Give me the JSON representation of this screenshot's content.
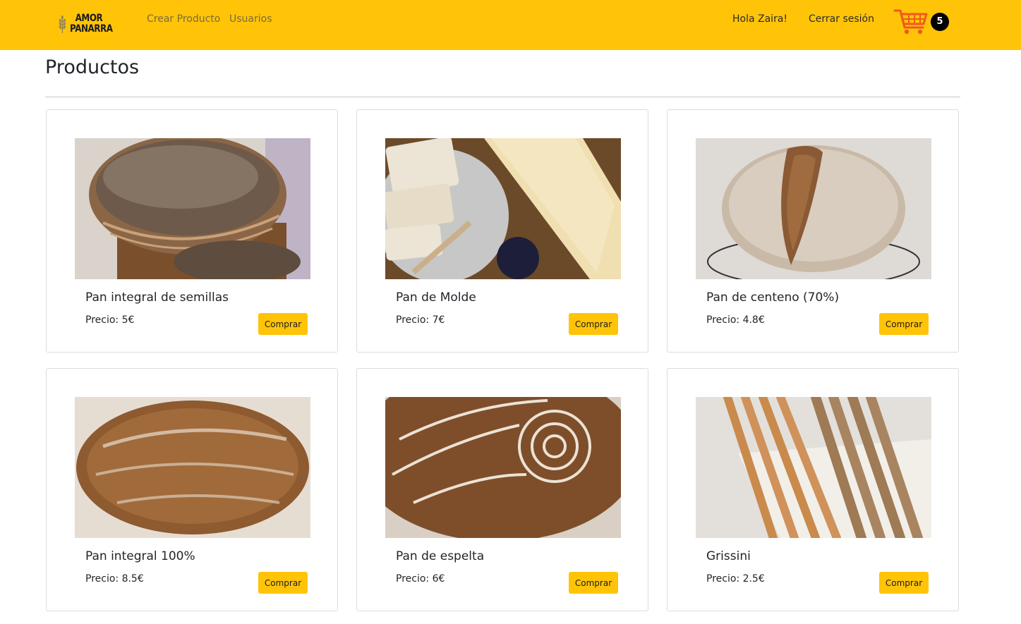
{
  "brand": {
    "line1": "AMOR",
    "line2": "PANARRA",
    "icon": "wheat-logo-icon"
  },
  "nav": {
    "links": [
      "Crear Producto",
      "Usuarios"
    ],
    "greeting": "Hola Zaira!",
    "logout": "Cerrar sesión",
    "cart_icon": "shopping-cart-icon",
    "cart_count": "5"
  },
  "page": {
    "title": "Productos"
  },
  "products": [
    {
      "name": "Pan integral de semillas",
      "price": "Precio: 5€",
      "button": "Comprar"
    },
    {
      "name": "Pan de Molde",
      "price": "Precio: 7€",
      "button": "Comprar"
    },
    {
      "name": "Pan de centeno (70%)",
      "price": "Precio: 4.8€",
      "button": "Comprar"
    },
    {
      "name": "Pan integral 100%",
      "price": "Precio: 8.5€",
      "button": "Comprar"
    },
    {
      "name": "Pan de espelta",
      "price": "Precio: 6€",
      "button": "Comprar"
    },
    {
      "name": "Grissini",
      "price": "Precio: 2.5€",
      "button": "Comprar"
    }
  ],
  "colors": {
    "navbar": "#ffc408",
    "button": "#ffc408",
    "cart": "#f05a1a",
    "badge": "#000000"
  }
}
